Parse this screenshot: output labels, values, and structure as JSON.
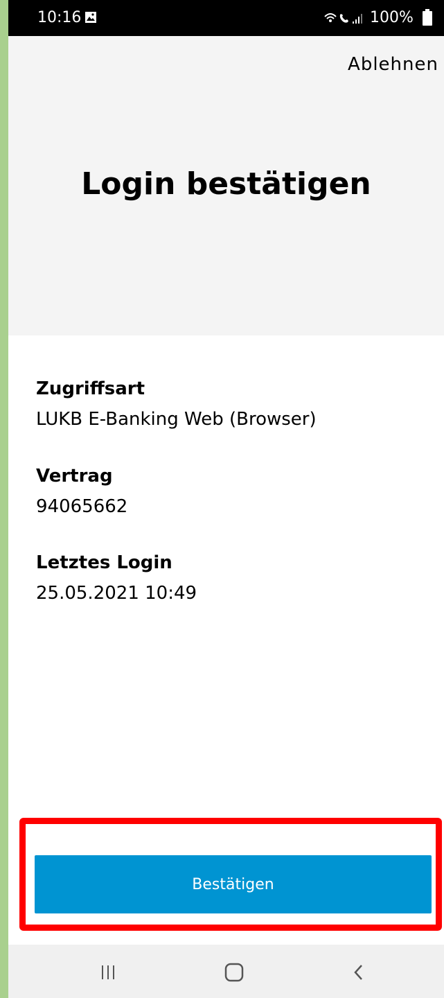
{
  "status_bar": {
    "time": "10:16",
    "battery": "100%",
    "icons": [
      "gallery-icon",
      "wifi-icon",
      "wifi-calling-icon",
      "signal-icon",
      "battery-icon"
    ]
  },
  "header": {
    "decline_label": "Ablehnen",
    "title": "Login bestätigen",
    "background": "#f4f4f4"
  },
  "details": {
    "access_type": {
      "label": "Zugriffsart",
      "value": "LUKB E-Banking Web (Browser)"
    },
    "contract": {
      "label": "Vertrag",
      "value": "94065662"
    },
    "last_login": {
      "label": "Letztes Login",
      "value": "25.05.2021 10:49"
    }
  },
  "confirm": {
    "label": "Bestätigen",
    "button_color": "#0094d2",
    "highlight_color": "#ff0000"
  },
  "nav_bar": {
    "items": [
      "recent-apps-icon",
      "home-icon",
      "back-icon"
    ]
  }
}
